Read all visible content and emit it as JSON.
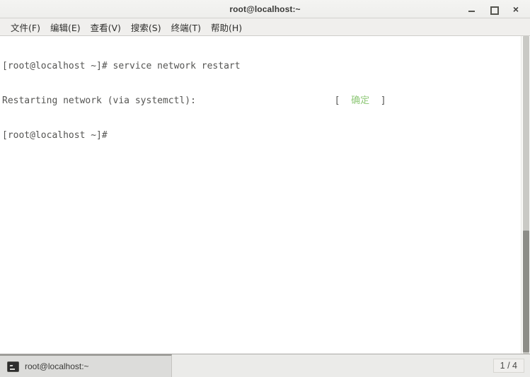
{
  "window": {
    "title": "root@localhost:~",
    "controls": {
      "minimize_label": "",
      "maximize_label": "",
      "close_label": "×",
      "minimize_name": "minimize",
      "maximize_name": "maximize",
      "close_name": "close"
    }
  },
  "menubar": {
    "items": [
      {
        "label": "文件(F)"
      },
      {
        "label": "编辑(E)"
      },
      {
        "label": "查看(V)"
      },
      {
        "label": "搜索(S)"
      },
      {
        "label": "终端(T)"
      },
      {
        "label": "帮助(H)"
      }
    ]
  },
  "terminal": {
    "background_color": "#ffffff",
    "text_color": "#555553",
    "ok_color": "#8fc878",
    "lines": [
      {
        "text": "[root@localhost ~]# service network restart"
      },
      {
        "prefix": "Restarting network (via systemctl):                         [  ",
        "status": "确定",
        "suffix": "  ]"
      },
      {
        "text": "[root@localhost ~]# "
      }
    ]
  },
  "statusbar": {
    "tab": {
      "label": "root@localhost:~",
      "icon": "terminal-icon"
    },
    "page_indicator": "1 / 4"
  }
}
